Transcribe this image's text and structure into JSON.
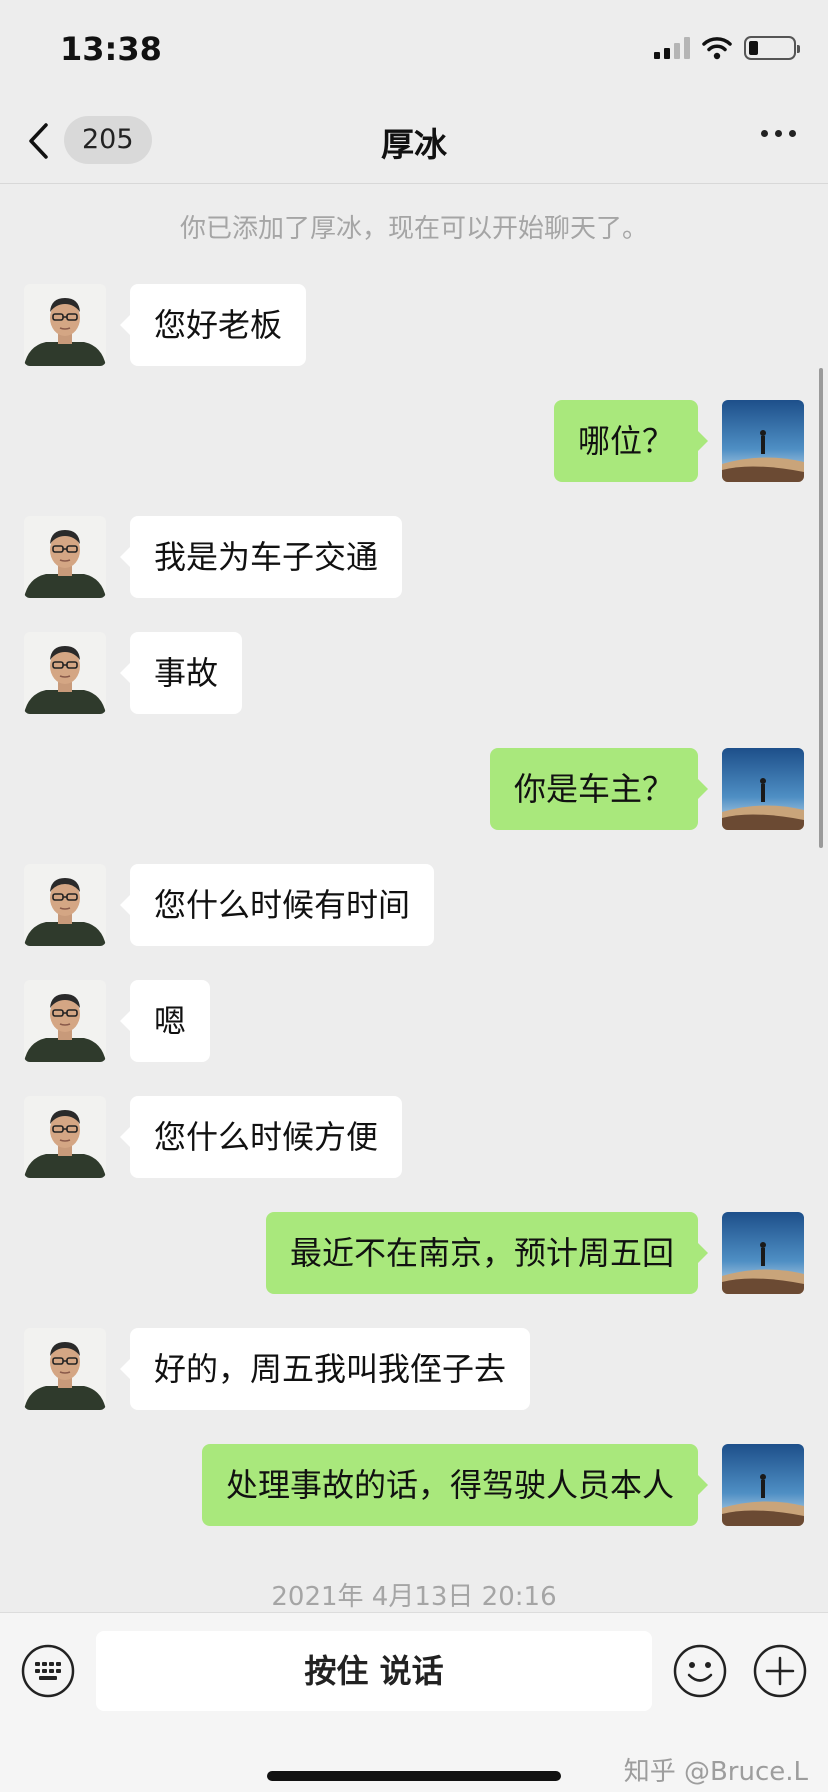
{
  "status_bar": {
    "time": "13:38"
  },
  "nav": {
    "unread_count": "205",
    "title": "厚冰"
  },
  "system_message": "你已添加了厚冰，现在可以开始聊天了。",
  "messages": [
    {
      "side": "left",
      "text": "您好老板"
    },
    {
      "side": "right",
      "text": "哪位？"
    },
    {
      "side": "left",
      "text": "我是为车子交通"
    },
    {
      "side": "left",
      "text": "事故"
    },
    {
      "side": "right",
      "text": "你是车主？"
    },
    {
      "side": "left",
      "text": "您什么时候有时间"
    },
    {
      "side": "left",
      "text": "嗯"
    },
    {
      "side": "left",
      "text": "您什么时候方便"
    },
    {
      "side": "right",
      "text": "最近不在南京，预计周五回"
    },
    {
      "side": "left",
      "text": "好的，周五我叫我侄子去"
    },
    {
      "side": "right",
      "text": "处理事故的话，得驾驶人员本人"
    }
  ],
  "timestamp": "2021年 4月13日 20:16",
  "input": {
    "voice_label": "按住 说话"
  },
  "watermark": "知乎 @Bruce.L",
  "colors": {
    "background": "#ededed",
    "sent_bubble": "#a9e87c",
    "received_bubble": "#ffffff"
  },
  "icons": {
    "back": "chevron-left-icon",
    "more": "more-dots-icon",
    "keyboard": "keyboard-icon",
    "emoji": "emoji-icon",
    "plus": "plus-icon",
    "contact_avatar": "contact-avatar",
    "my_avatar": "my-avatar-mountain"
  }
}
